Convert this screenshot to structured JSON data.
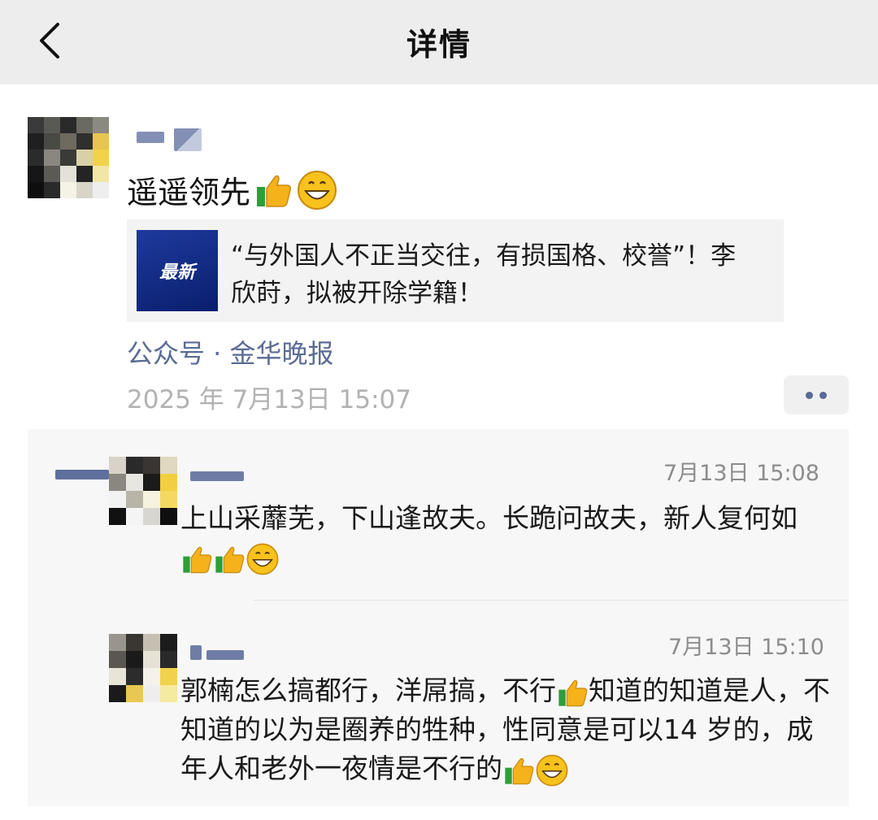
{
  "nav": {
    "title": "详情",
    "back_icon": "chevron-left-icon"
  },
  "post": {
    "text": "遥遥领先",
    "emojis": [
      "thumbs-up-icon",
      "grin-icon"
    ],
    "link": {
      "thumb_text": "最新",
      "title": "“与外国人不正当交往，有损国格、校誉”！李欣莳，拟被开除学籍！"
    },
    "source": "公众号 · 金华晚报",
    "timestamp": "2025 年 7月13日 15:07",
    "more_icon": "more-dots-icon"
  },
  "comments": [
    {
      "time": "7月13日 15:08",
      "text": "上山采蘼芜，下山逢故夫。长跪问故夫，新人复何如",
      "emojis": [
        "thumbs-up-icon",
        "thumbs-up-icon",
        "grin-icon"
      ]
    },
    {
      "time": "7月13日 15:10",
      "text_part1": "郭楠怎么搞都行，洋屌搞，不行",
      "text_part2": "知道的知道是人，不知道的以为是圈养的牲种，性同意是可以14 岁的，成年人和老外一夜情是不行的",
      "emojis": [
        "thumbs-up-icon",
        "thumbs-up-icon",
        "grin-icon"
      ]
    }
  ],
  "colors": {
    "link_blue": "#5b6b95",
    "time_gray": "#b2b2b2",
    "nav_bg": "#ededed"
  }
}
